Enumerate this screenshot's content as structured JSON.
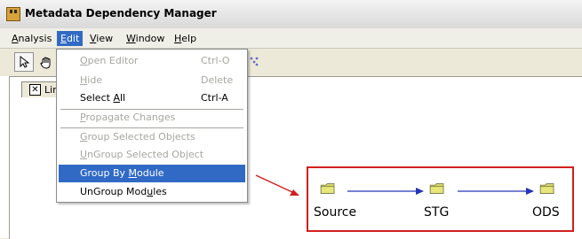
{
  "window": {
    "title": "Metadata Dependency Manager"
  },
  "menubar": {
    "items": [
      {
        "label_pre": "",
        "label_u": "A",
        "label_post": "nalysis"
      },
      {
        "label_pre": "",
        "label_u": "E",
        "label_post": "dit"
      },
      {
        "label_pre": "",
        "label_u": "V",
        "label_post": "iew"
      },
      {
        "label_pre": "",
        "label_u": "W",
        "label_post": "indow"
      },
      {
        "label_pre": "",
        "label_u": "H",
        "label_post": "elp"
      }
    ]
  },
  "tab": {
    "label": "Lin",
    "close_glyph": "✕"
  },
  "edit_menu": {
    "items": [
      {
        "pre": "",
        "u": "O",
        "post": "pen Editor",
        "shortcut": "Ctrl-O",
        "enabled": false
      },
      {
        "pre": "",
        "u": "H",
        "post": "ide",
        "shortcut": "Delete",
        "enabled": false
      },
      {
        "pre": "Select ",
        "u": "A",
        "post": "ll",
        "shortcut": "Ctrl-A",
        "enabled": true
      },
      {
        "pre": "",
        "u": "P",
        "post": "ropagate Changes",
        "shortcut": "",
        "enabled": false
      },
      {
        "pre": "",
        "u": "G",
        "post": "roup Selected Objects",
        "shortcut": "",
        "enabled": false
      },
      {
        "pre": "",
        "u": "U",
        "post": "nGroup Selected Object",
        "shortcut": "",
        "enabled": false
      },
      {
        "pre": "Group By ",
        "u": "M",
        "post": "odule",
        "shortcut": "",
        "enabled": true,
        "highlighted": true
      },
      {
        "pre": "UnGroup Mod",
        "u": "u",
        "post": "les",
        "shortcut": "",
        "enabled": true
      }
    ]
  },
  "diagram": {
    "nodes": [
      "Source",
      "STG",
      "ODS"
    ]
  },
  "colors": {
    "highlight": "#316ac5",
    "callout": "#d21f1f",
    "edge": "#2334b7",
    "folder": "#d8d86a"
  }
}
